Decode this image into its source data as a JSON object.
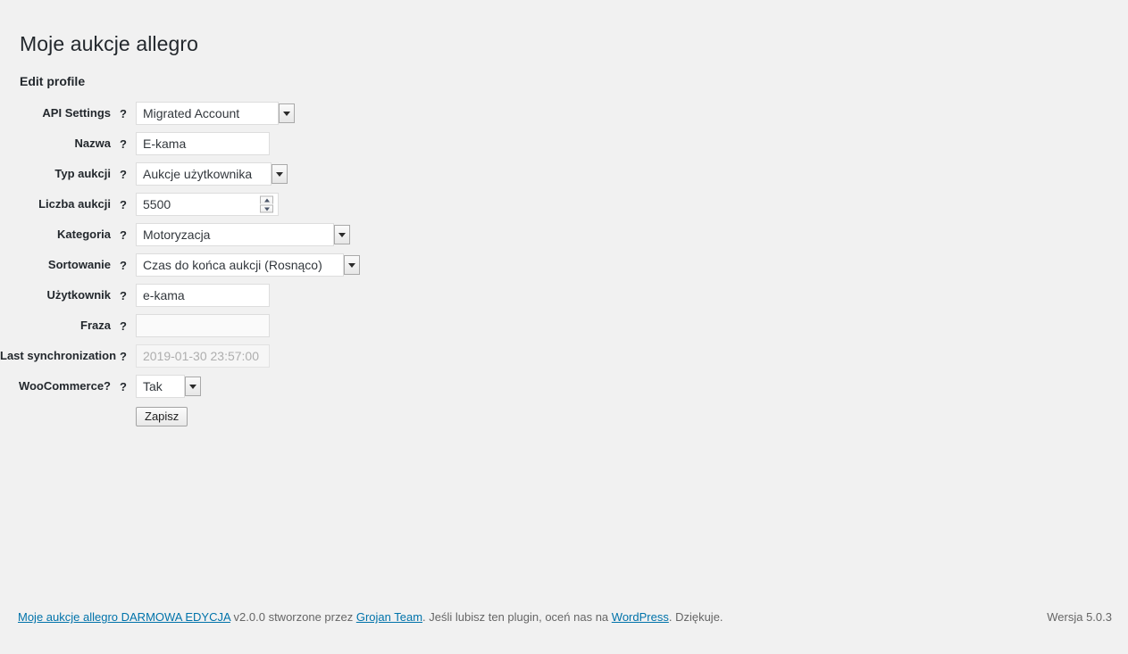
{
  "page": {
    "title": "Moje aukcje allegro",
    "section_title": "Edit profile",
    "help_marker": "?"
  },
  "form": {
    "rows": [
      {
        "label": "API Settings",
        "type": "select",
        "value": "Migrated Account"
      },
      {
        "label": "Nazwa",
        "type": "text",
        "value": "E-kama"
      },
      {
        "label": "Typ aukcji",
        "type": "select",
        "value": "Aukcje użytkownika"
      },
      {
        "label": "Liczba aukcji",
        "type": "number",
        "value": "5500"
      },
      {
        "label": "Kategoria",
        "type": "select",
        "value": "Motoryzacja"
      },
      {
        "label": "Sortowanie",
        "type": "select",
        "value": "Czas do końca aukcji (Rosnąco)"
      },
      {
        "label": "Użytkownik",
        "type": "text",
        "value": "e-kama"
      },
      {
        "label": "Fraza",
        "type": "text",
        "value": ""
      },
      {
        "label": "Last synchronization",
        "type": "text",
        "value": "2019-01-30 23:57:00",
        "disabled": true
      },
      {
        "label": "WooCommerce?",
        "type": "select",
        "value": "Tak"
      }
    ],
    "submit_label": "Zapisz"
  },
  "footer": {
    "link1": "Moje aukcje allegro DARMOWA EDYCJA",
    "text1": " v2.0.0 stworzone przez ",
    "link2": "Grojan Team",
    "text2": ". Jeśli lubisz ten plugin, oceń nas na ",
    "link3": "WordPress",
    "text3": ". Dziękuje.",
    "version": "Wersja 5.0.3"
  },
  "colors": {
    "background": "#f1f1f1",
    "heading": "#23282d",
    "link": "#0073aa",
    "text": "#666666"
  }
}
